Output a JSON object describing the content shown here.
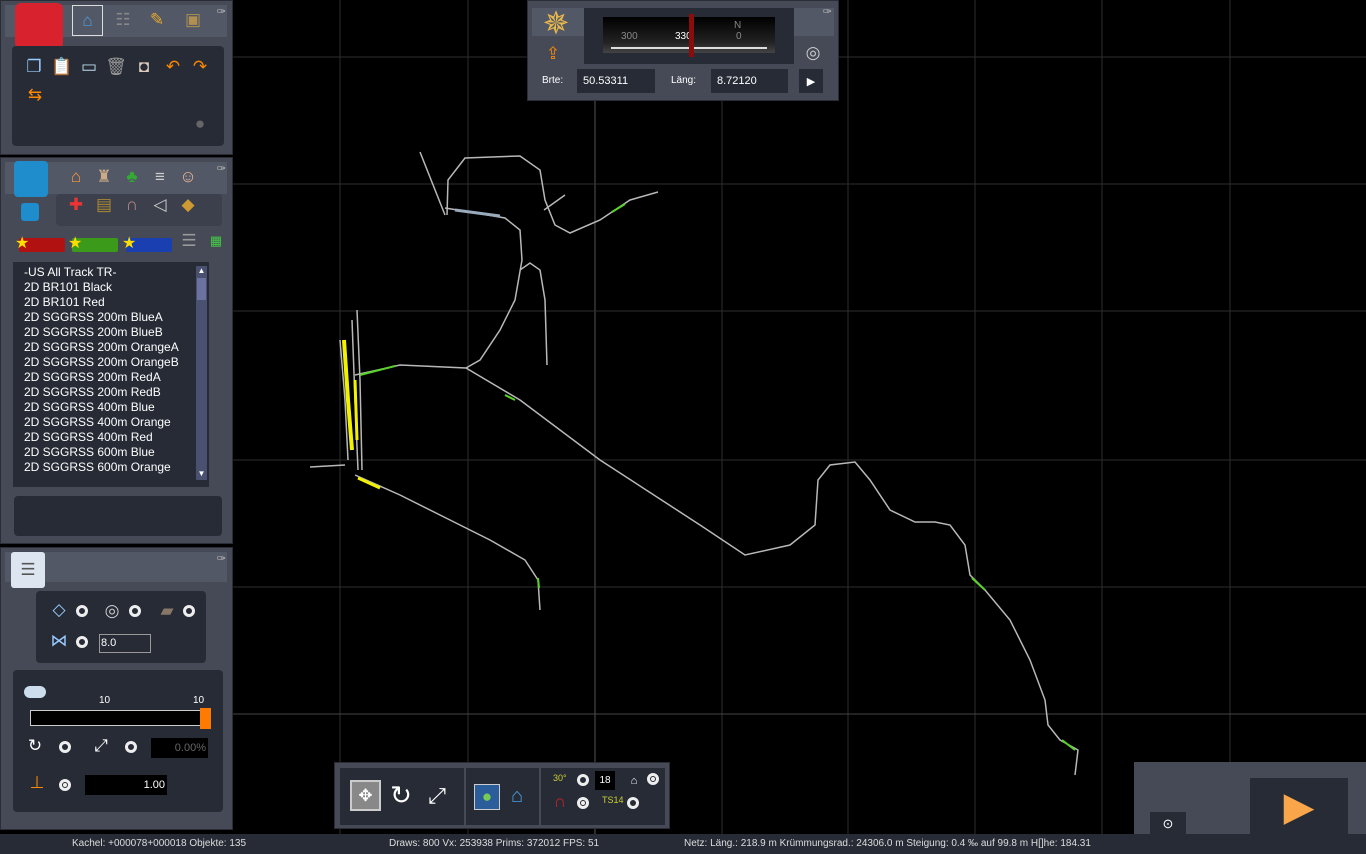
{
  "toolbox": {
    "tabs": [
      "home",
      "track",
      "paint",
      "train"
    ],
    "tools": [
      "copy",
      "paste",
      "screen",
      "trash",
      "measure",
      "undo",
      "redo",
      "move"
    ]
  },
  "objects": {
    "categories": [
      "house",
      "industry",
      "tree",
      "road",
      "person",
      "signal",
      "bench",
      "bridge",
      "sound",
      "bag"
    ],
    "list": [
      "-US All Track TR-",
      "2D BR101 Black",
      "2D BR101 Red",
      "2D SGGRSS 200m BlueA",
      "2D SGGRSS 200m BlueB",
      "2D SGGRSS 200m OrangeA",
      "2D SGGRSS 200m OrangeB",
      "2D SGGRSS 200m RedA",
      "2D SGGRSS 200m RedB",
      "2D SGGRSS 400m Blue",
      "2D SGGRSS 400m Orange",
      "2D SGGRSS 400m Red",
      "2D SGGRSS 600m Blue",
      "2D SGGRSS 600m Orange"
    ]
  },
  "properties": {
    "grid_value": "8.0",
    "slider_min_label": "10",
    "slider_max_label": "10",
    "slider_fraction": 1.0,
    "percent": "0.00%",
    "height_value": "1.00"
  },
  "compass": {
    "ticks": [
      "300",
      "330",
      "0"
    ],
    "north": "N",
    "lat_label": "Brte:",
    "lat": "50.53311",
    "lon_label": "Läng:",
    "lon": "8.72120"
  },
  "bottombar": {
    "value": "18",
    "ts_label": "TS14",
    "angle_label": "30°"
  },
  "status": {
    "tile": "Kachel: +000078+000018  Objekte: 135",
    "stats": "Draws: 800 Vx: 253938 Prims: 372012 FPS: 51",
    "net": "Netz:  Läng.:  218.9 m Krümmungsrad.: 24306.0 m Steigung:  0.4 ‰ auf 99.8 m H[]he: 184.31"
  },
  "colors": {
    "accent": "#ff7a00",
    "track": "#b8b8b8",
    "yard": "#f2f200",
    "green": "#5ad22a"
  }
}
